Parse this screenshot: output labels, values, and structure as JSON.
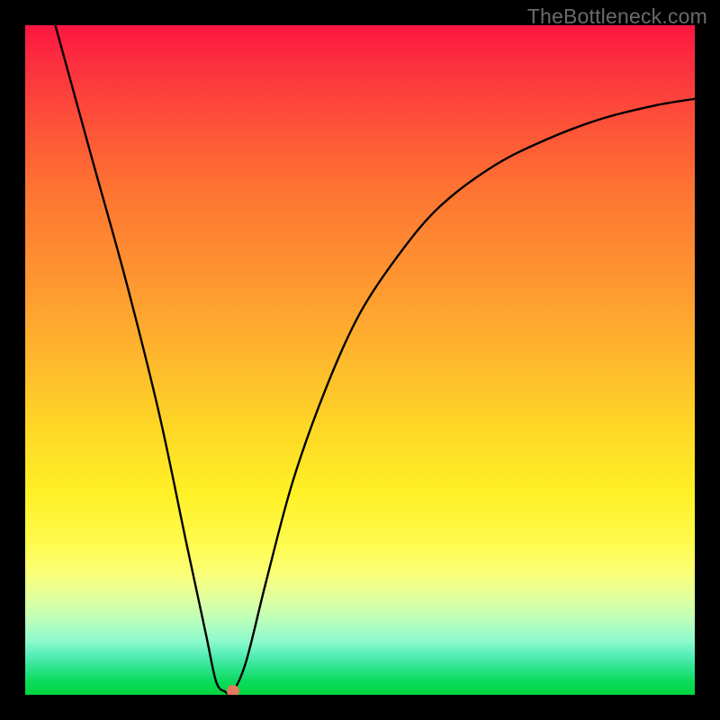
{
  "watermark": "TheBottleneck.com",
  "chart_data": {
    "type": "line",
    "title": "",
    "xlabel": "",
    "ylabel": "",
    "xlim": [
      0,
      100
    ],
    "ylim": [
      0,
      100
    ],
    "curve": {
      "name": "bottleneck-curve",
      "points": [
        {
          "x": 4.5,
          "y": 100
        },
        {
          "x": 10,
          "y": 80
        },
        {
          "x": 15,
          "y": 62
        },
        {
          "x": 20,
          "y": 42
        },
        {
          "x": 24,
          "y": 23
        },
        {
          "x": 27,
          "y": 9
        },
        {
          "x": 28.5,
          "y": 2
        },
        {
          "x": 29.8,
          "y": 0.5
        },
        {
          "x": 31,
          "y": 0.5
        },
        {
          "x": 33,
          "y": 5
        },
        {
          "x": 36,
          "y": 17
        },
        {
          "x": 40,
          "y": 32
        },
        {
          "x": 45,
          "y": 46
        },
        {
          "x": 50,
          "y": 57
        },
        {
          "x": 56,
          "y": 66
        },
        {
          "x": 62,
          "y": 73
        },
        {
          "x": 70,
          "y": 79
        },
        {
          "x": 78,
          "y": 83
        },
        {
          "x": 86,
          "y": 86
        },
        {
          "x": 94,
          "y": 88
        },
        {
          "x": 100,
          "y": 89
        }
      ]
    },
    "min_marker": {
      "x": 31,
      "y": 0.5
    },
    "gradient_stops": [
      {
        "pct": 0,
        "color": "#fb1640"
      },
      {
        "pct": 50,
        "color": "#feb82d"
      },
      {
        "pct": 78,
        "color": "#fffc52"
      },
      {
        "pct": 100,
        "color": "#00d63d"
      }
    ]
  }
}
